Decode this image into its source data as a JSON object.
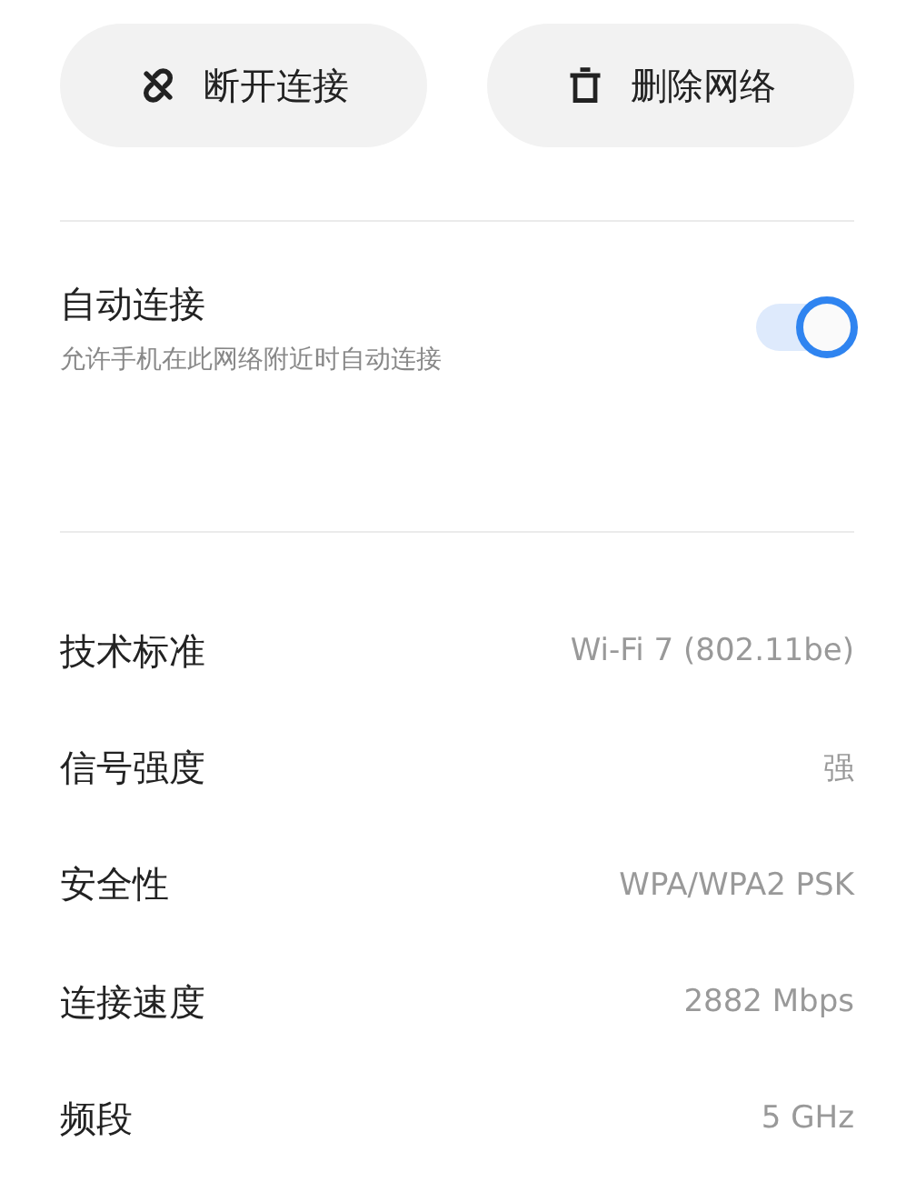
{
  "actions": [
    {
      "kind": "disconnect",
      "label": "断开连接"
    },
    {
      "kind": "delete",
      "label": "删除网络"
    }
  ],
  "auto_connect": {
    "title": "自动连接",
    "description": "允许手机在此网络附近时自动连接",
    "on": true
  },
  "details": [
    {
      "label": "技术标准",
      "value": "Wi-Fi 7 (802.11be)"
    },
    {
      "label": "信号强度",
      "value": "强"
    },
    {
      "label": "安全性",
      "value": "WPA/WPA2 PSK"
    },
    {
      "label": "连接速度",
      "value": "2882 Mbps"
    },
    {
      "label": "频段",
      "value": "5 GHz"
    }
  ]
}
